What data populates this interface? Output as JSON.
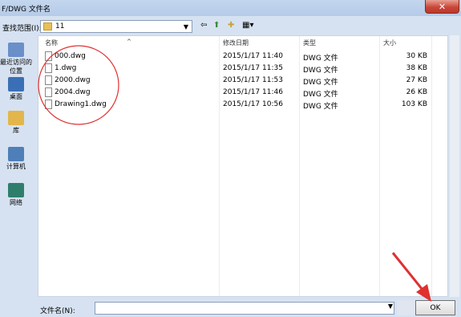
{
  "dialog": {
    "title": "F/DWG 文件名",
    "close_glyph": "✕"
  },
  "toolbar": {
    "lookin_label": "查找范围(I):",
    "path": "11",
    "back_glyph": "⇦",
    "up_glyph": "⬆",
    "newfolder_glyph": "✚",
    "views_glyph": "▦▾"
  },
  "places": [
    {
      "label": "最近访问的位置",
      "icon": "recent-icon",
      "color": "#6a8fc9"
    },
    {
      "label": "桌面",
      "icon": "desktop-icon",
      "color": "#3b6fb5"
    },
    {
      "label": "库",
      "icon": "library-icon",
      "color": "#e2b64a"
    },
    {
      "label": "计算机",
      "icon": "computer-icon",
      "color": "#4f7fb8"
    },
    {
      "label": "网络",
      "icon": "network-icon",
      "color": "#2f7e6b"
    }
  ],
  "columns": {
    "name": "名称",
    "modified": "修改日期",
    "type": "类型",
    "size": "大小"
  },
  "files": [
    {
      "name": "000.dwg",
      "modified": "2015/1/17 11:40",
      "type": "DWG 文件",
      "size": "30 KB"
    },
    {
      "name": "1.dwg",
      "modified": "2015/1/17 11:35",
      "type": "DWG 文件",
      "size": "38 KB"
    },
    {
      "name": "2000.dwg",
      "modified": "2015/1/17 11:53",
      "type": "DWG 文件",
      "size": "27 KB"
    },
    {
      "name": "2004.dwg",
      "modified": "2015/1/17 11:46",
      "type": "DWG 文件",
      "size": "26 KB"
    },
    {
      "name": "Drawing1.dwg",
      "modified": "2015/1/17 10:56",
      "type": "DWG 文件",
      "size": "103 KB"
    }
  ],
  "footer": {
    "filename_label": "文件名(N):",
    "filename_value": "",
    "ok_label": "OK"
  },
  "colors": {
    "annotation_red": "#e03030"
  }
}
